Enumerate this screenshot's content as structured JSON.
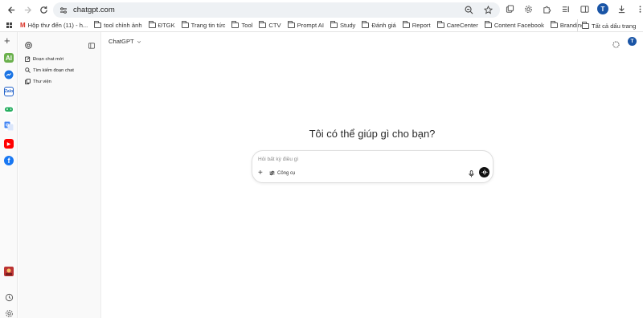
{
  "browser": {
    "url": "chatgpt.com",
    "profile_initial": "T",
    "bookmarks": [
      {
        "label": "Hộp thư đến (11) - h...",
        "icon": "gmail-icon"
      },
      {
        "label": "tool chỉnh ảnh",
        "icon": "folder-icon"
      },
      {
        "label": "ĐTGK",
        "icon": "folder-icon"
      },
      {
        "label": "Trang tin tức",
        "icon": "folder-icon"
      },
      {
        "label": "Tool",
        "icon": "folder-icon"
      },
      {
        "label": "CTV",
        "icon": "folder-icon"
      },
      {
        "label": "Prompt AI",
        "icon": "folder-icon"
      },
      {
        "label": "Study",
        "icon": "folder-icon"
      },
      {
        "label": "Đánh giá",
        "icon": "folder-icon"
      },
      {
        "label": "Report",
        "icon": "folder-icon"
      },
      {
        "label": "CareCenter",
        "icon": "folder-icon"
      },
      {
        "label": "Content Facebook",
        "icon": "folder-icon"
      },
      {
        "label": "Branding",
        "icon": "folder-icon"
      }
    ],
    "all_bookmarks": "Tất cả dấu trang"
  },
  "sidebar": {
    "items": [
      {
        "label": "Đoạn chat mới",
        "icon": "new-chat-icon"
      },
      {
        "label": "Tìm kiếm đoạn chat",
        "icon": "search-icon"
      },
      {
        "label": "Thư viện",
        "icon": "library-icon"
      }
    ]
  },
  "main": {
    "model": "ChatGPT",
    "headline": "Tôi có thể giúp gì cho bạn?",
    "composer": {
      "placeholder": "Hỏi bất kỳ điều gì",
      "tools_label": "Công cụ"
    }
  },
  "colors": {
    "accent": "#111111",
    "profile": "#1a55a6"
  }
}
